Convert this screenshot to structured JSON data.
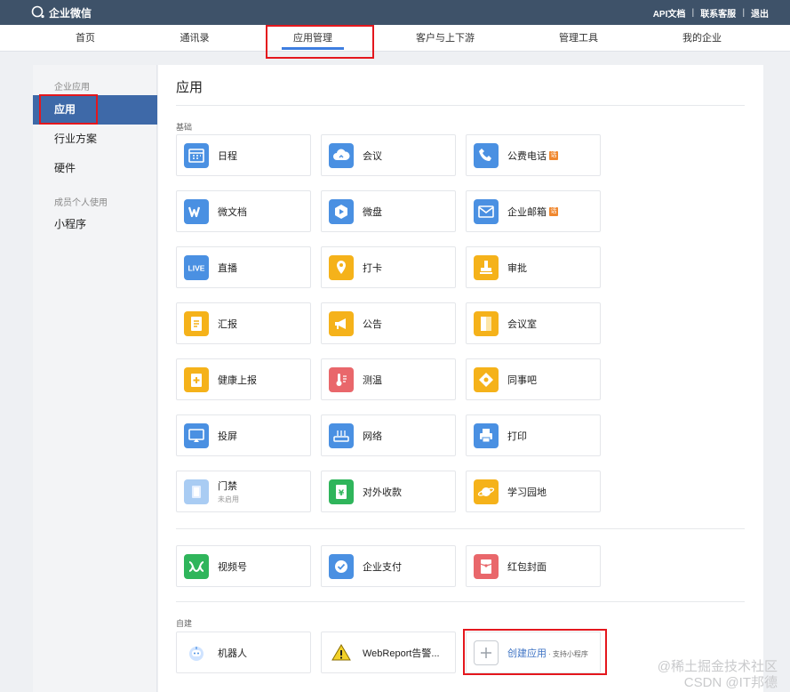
{
  "app": {
    "logo_text": "企业微信"
  },
  "toplinks": [
    "API文档",
    "联系客服",
    "退出"
  ],
  "nav": [
    "首页",
    "通讯录",
    "应用管理",
    "客户与上下游",
    "管理工具",
    "我的企业"
  ],
  "sidebar": {
    "group1": "企业应用",
    "items1": [
      "应用",
      "行业方案",
      "硬件"
    ],
    "group2": "成员个人使用",
    "items2": [
      "小程序"
    ]
  },
  "main": {
    "title": "应用",
    "section_basic": "基础",
    "section_custom": "自建",
    "basic_apps": [
      {
        "name": "日程",
        "icon": "calendar-icon",
        "color": "#4a90e2"
      },
      {
        "name": "会议",
        "icon": "cloud-meeting-icon",
        "color": "#4a90e2"
      },
      {
        "name": "公费电话",
        "icon": "phone-icon",
        "color": "#4a90e2",
        "badge": "话"
      },
      {
        "name": "微文档",
        "icon": "w-doc-icon",
        "color": "#4a90e2"
      },
      {
        "name": "微盘",
        "icon": "drive-icon",
        "color": "#4a90e2"
      },
      {
        "name": "企业邮箱",
        "icon": "mail-icon",
        "color": "#4a90e2",
        "badge": "话"
      },
      {
        "name": "直播",
        "icon": "live-icon",
        "color": "#4a90e2"
      },
      {
        "name": "打卡",
        "icon": "location-icon",
        "color": "#f5b21a"
      },
      {
        "name": "审批",
        "icon": "stamp-icon",
        "color": "#f5b21a"
      },
      {
        "name": "汇报",
        "icon": "report-icon",
        "color": "#f5b21a"
      },
      {
        "name": "公告",
        "icon": "megaphone-icon",
        "color": "#f5b21a"
      },
      {
        "name": "会议室",
        "icon": "door-icon",
        "color": "#f5b21a"
      },
      {
        "name": "健康上报",
        "icon": "health-icon",
        "color": "#f5b21a"
      },
      {
        "name": "测温",
        "icon": "thermometer-icon",
        "color": "#e9676b"
      },
      {
        "name": "同事吧",
        "icon": "colleague-icon",
        "color": "#f5b21a"
      },
      {
        "name": "投屏",
        "icon": "cast-icon",
        "color": "#4a90e2"
      },
      {
        "name": "网络",
        "icon": "router-icon",
        "color": "#4a90e2"
      },
      {
        "name": "打印",
        "icon": "printer-icon",
        "color": "#4a90e2"
      },
      {
        "name": "门禁",
        "sub": "未启用",
        "icon": "door-access-icon",
        "color": "#a9ccf3"
      },
      {
        "name": "对外收款",
        "icon": "payment-icon",
        "color": "#2fb55b"
      },
      {
        "name": "学习园地",
        "icon": "planet-icon",
        "color": "#f5b21a"
      }
    ],
    "extra_apps": [
      {
        "name": "视频号",
        "icon": "channels-icon",
        "color": "#2fb55b"
      },
      {
        "name": "企业支付",
        "icon": "pay-icon",
        "color": "#4a90e2"
      },
      {
        "name": "红包封面",
        "icon": "red-envelope-icon",
        "color": "#e9676b"
      }
    ],
    "custom_apps": [
      {
        "name": "机器人",
        "icon": "robot-icon"
      },
      {
        "name": "WebReport告警...",
        "icon": "warning-icon"
      }
    ],
    "create": {
      "name": "创建应用",
      "hint": "· 支持小程序"
    }
  },
  "watermark": {
    "line1": "@稀土掘金技术社区",
    "line2": "CSDN @IT邦德"
  }
}
